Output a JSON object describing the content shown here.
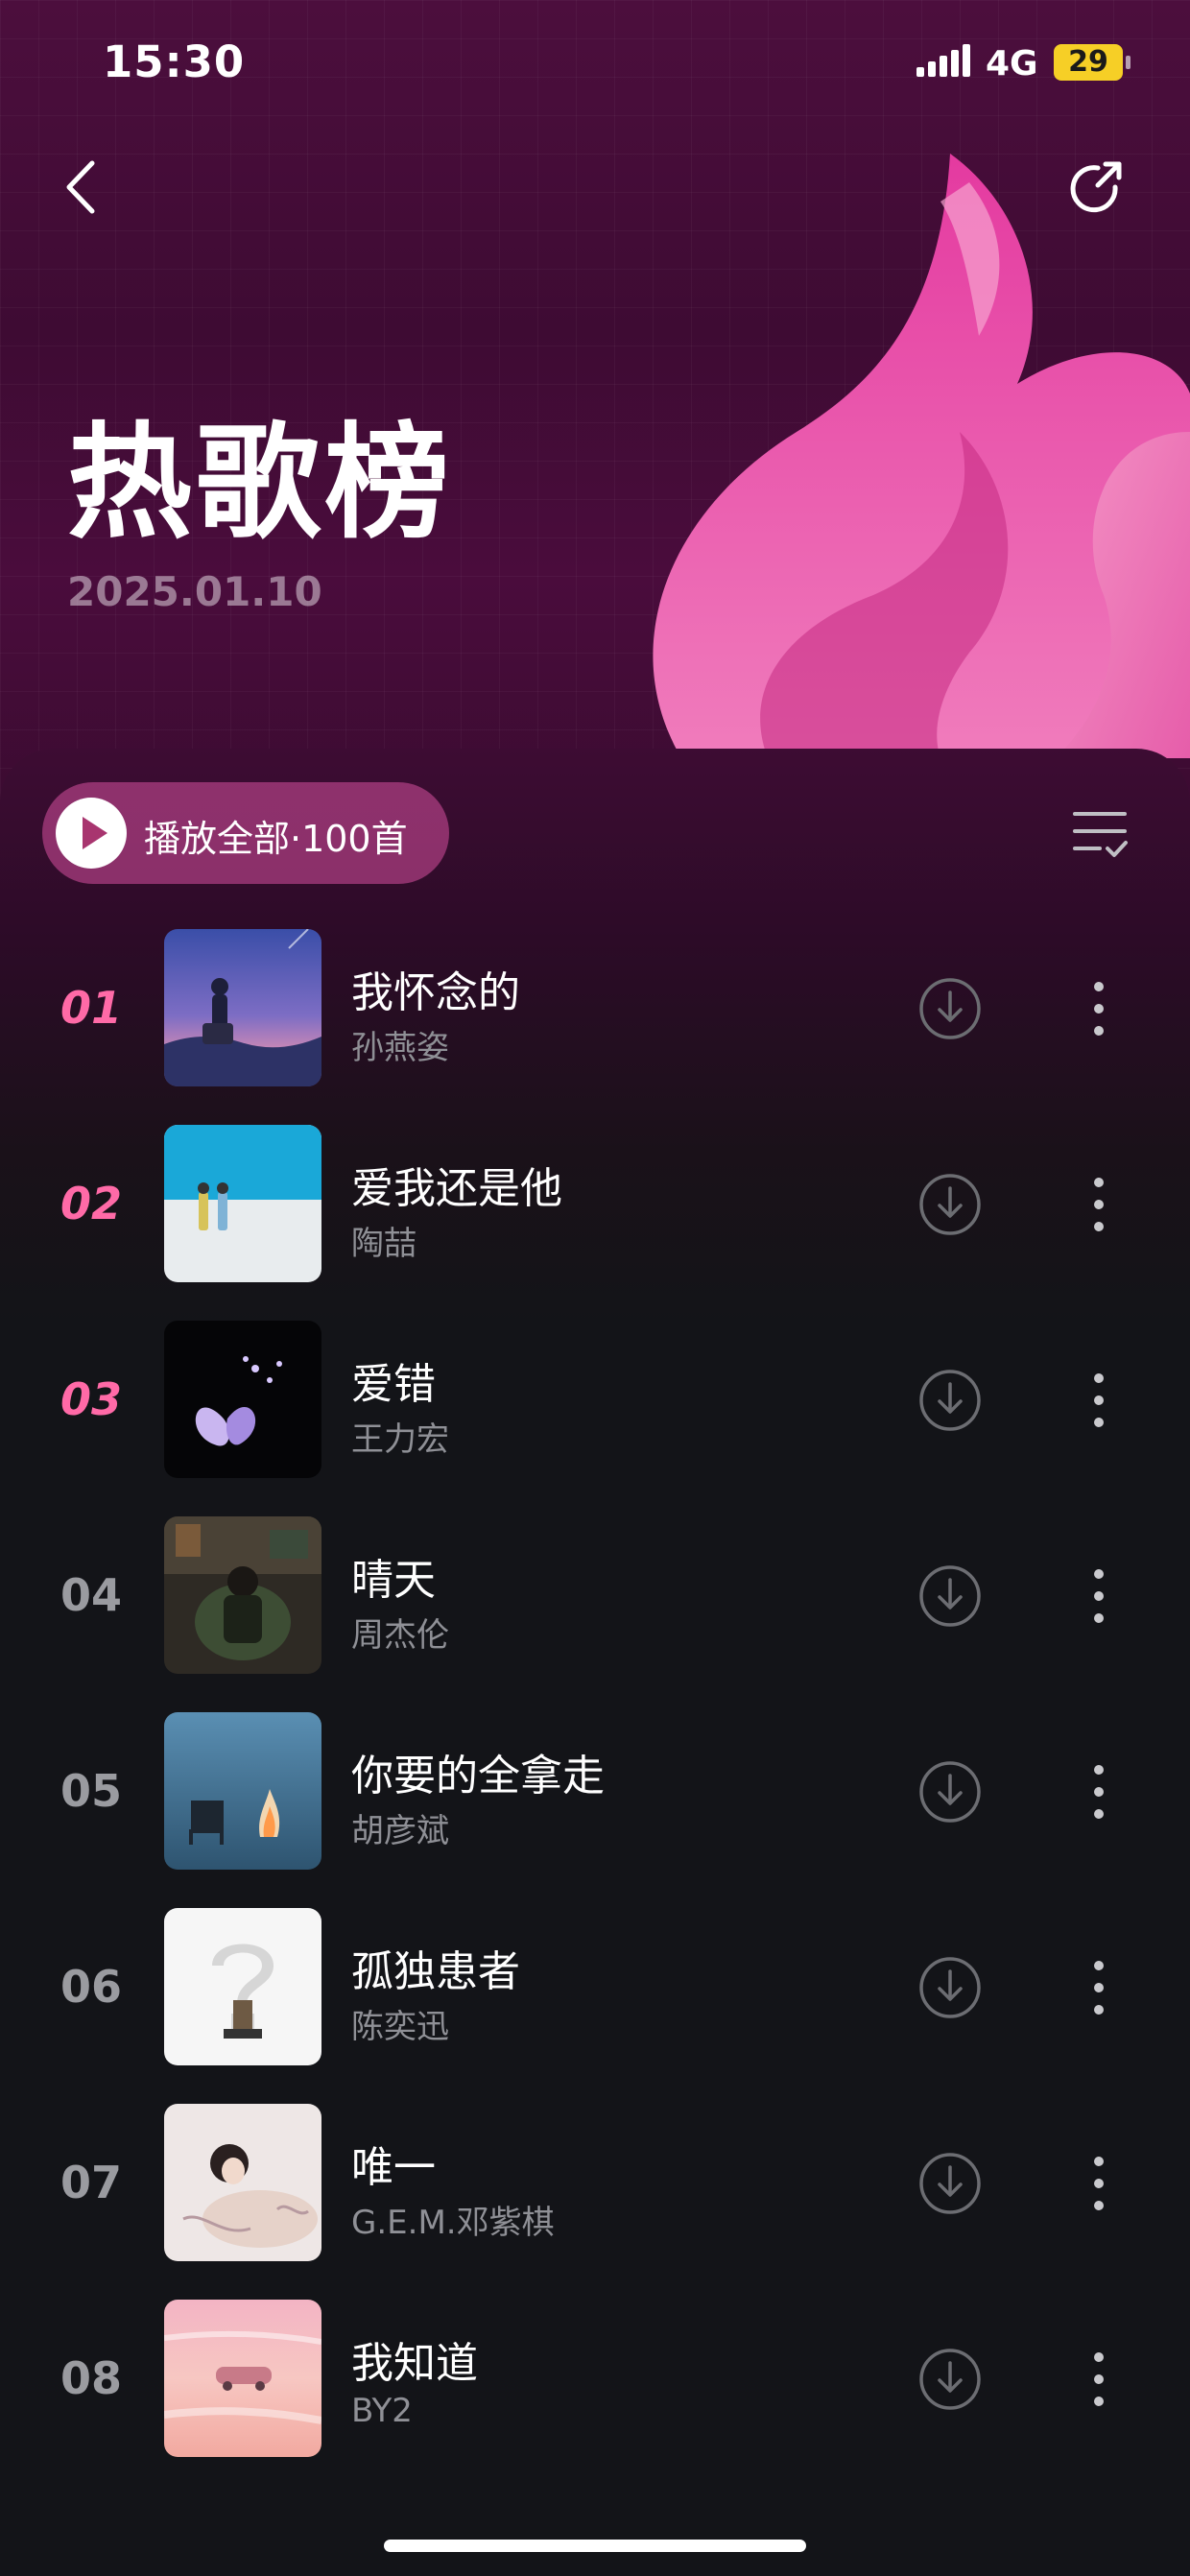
{
  "status_bar": {
    "time": "15:30",
    "network": "4G",
    "battery": "29"
  },
  "header": {
    "title": "热歌榜",
    "date": "2025.01.10"
  },
  "colors": {
    "accent": "#ff6aa7",
    "hero_bg": "#4c0e3d",
    "flame": "#e0489e",
    "battery": "#f6cf26"
  },
  "toolbar": {
    "play_all_label": "播放全部·100首"
  },
  "songs": [
    {
      "rank": "01",
      "title": "我怀念的",
      "artist": "孙燕姿"
    },
    {
      "rank": "02",
      "title": "爱我还是他",
      "artist": "陶喆"
    },
    {
      "rank": "03",
      "title": "爱错",
      "artist": "王力宏"
    },
    {
      "rank": "04",
      "title": "晴天",
      "artist": "周杰伦"
    },
    {
      "rank": "05",
      "title": "你要的全拿走",
      "artist": "胡彦斌"
    },
    {
      "rank": "06",
      "title": "孤独患者",
      "artist": "陈奕迅"
    },
    {
      "rank": "07",
      "title": "唯一",
      "artist": "G.E.M.邓紫棋"
    },
    {
      "rank": "08",
      "title": "我知道",
      "artist": "BY2"
    }
  ]
}
